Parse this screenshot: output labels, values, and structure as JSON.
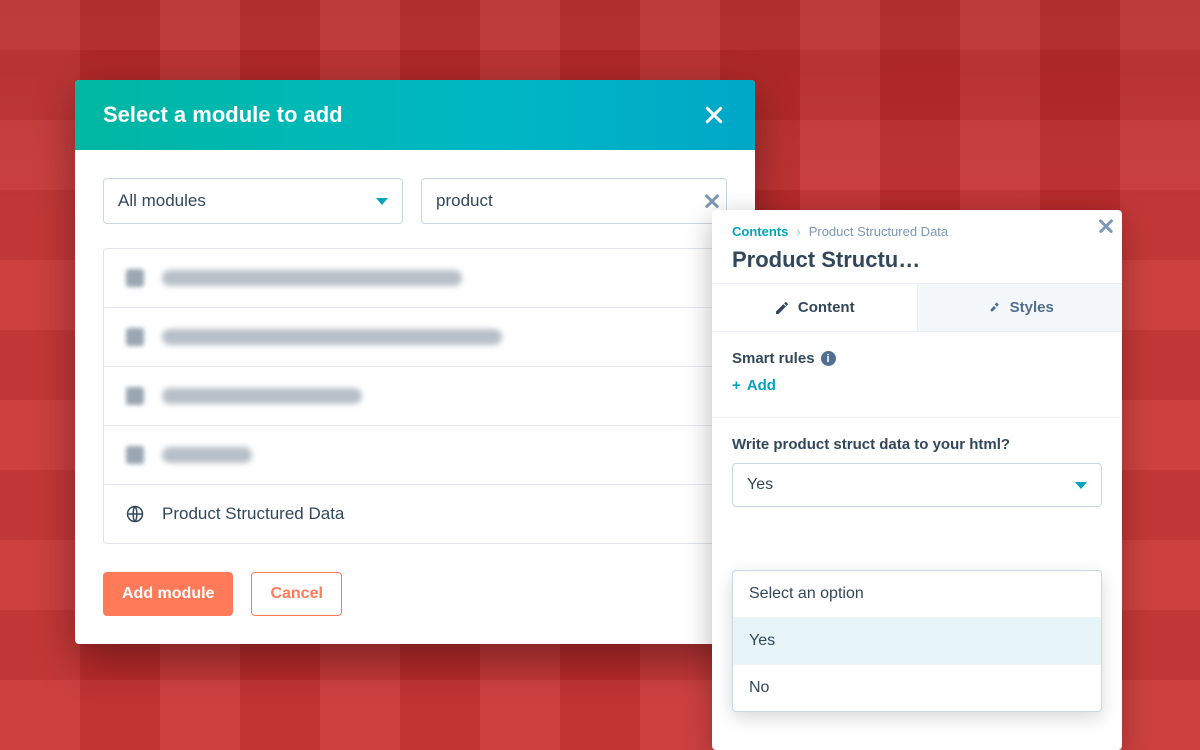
{
  "modal": {
    "title": "Select a module to add",
    "filter_select": "All modules",
    "search_value": "product",
    "items": [
      {
        "blurred": true
      },
      {
        "blurred": true
      },
      {
        "blurred": true
      },
      {
        "blurred": true
      },
      {
        "blurred": false,
        "label": "Product Structured Data"
      }
    ],
    "primary_btn": "Add module",
    "secondary_btn": "Cancel"
  },
  "panel": {
    "crumb_root": "Contents",
    "crumb_current": "Product Structured Data",
    "title": "Product Structu…",
    "tabs": {
      "content": "Content",
      "styles": "Styles"
    },
    "smart_rules_label": "Smart rules",
    "add_label": "Add",
    "field_label": "Write product struct data to your html?",
    "selected_value": "Yes",
    "options": {
      "placeholder": "Select an option",
      "opt_yes": "Yes",
      "opt_no": "No"
    }
  }
}
